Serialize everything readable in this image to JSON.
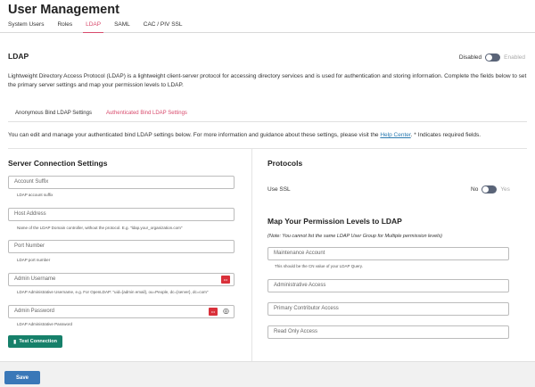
{
  "header": {
    "title": "User Management",
    "tabs": [
      {
        "label": "System Users",
        "active": false
      },
      {
        "label": "Roles",
        "active": false
      },
      {
        "label": "LDAP",
        "active": true
      },
      {
        "label": "SAML",
        "active": false
      },
      {
        "label": "CAC / PIV SSL",
        "active": false
      }
    ]
  },
  "ldap": {
    "title": "LDAP",
    "toggle_off_label": "Disabled",
    "toggle_on_label": "Enabled",
    "enabled": false,
    "description": "Lightweight Directory Access Protocol (LDAP) is a lightweight client-server protocol for accessing directory services and is used for authentication and storing information. Complete the fields below to set the primary server settings and map your permission levels to LDAP."
  },
  "sub_tabs": [
    {
      "label": "Anonymous Bind LDAP Settings",
      "active": false
    },
    {
      "label": "Authenticated Bind LDAP Settings",
      "active": true
    }
  ],
  "helper": {
    "text_before": "You can edit and manage your authenticated bind LDAP settings below. For more information and guidance about these settings, please visit the ",
    "link": "Help Center",
    "text_after": ". * Indicates required fields."
  },
  "server": {
    "title": "Server Connection Settings",
    "account_suffix": {
      "placeholder": "Account Suffix",
      "hint": "LDAP account suffix"
    },
    "host_address": {
      "placeholder": "Host Address",
      "hint": "Name of the LDAP Domain controller, without the protocol. E.g. \"ldap.your_organization.com\""
    },
    "port_number": {
      "placeholder": "Port Number",
      "hint": "LDAP port number"
    },
    "admin_username": {
      "placeholder": "Admin Username",
      "hint": "LDAP Administrative Username, e.g. For OpenLDAP: \"uid={admin email}, ou=People, dc={server}, dc=com\""
    },
    "admin_password": {
      "placeholder": "Admin Password",
      "hint": "LDAP Administrative Password"
    },
    "test_button": "Test Connection"
  },
  "protocols": {
    "title": "Protocols",
    "ssl_label": "Use SSL",
    "ssl_off": "No",
    "ssl_on": "Yes"
  },
  "permissions": {
    "title": "Map Your Permission Levels to LDAP",
    "note": "(Note: You cannot list the same LDAP User Group for Multiple permission levels)",
    "maintenance": {
      "placeholder": "Maintenance Account",
      "hint": "This should be the CN value of your LDAP Query."
    },
    "administrative": {
      "placeholder": "Administrative Access"
    },
    "primary_contributor": {
      "placeholder": "Primary Contributor Access"
    },
    "read_only": {
      "placeholder": "Read Only Access"
    }
  },
  "footer": {
    "save_label": "Save"
  },
  "colors": {
    "accent": "#d84a6c",
    "primary_button": "#3a78b8",
    "test_button": "#16806a",
    "key_icon": "#d9303a"
  }
}
